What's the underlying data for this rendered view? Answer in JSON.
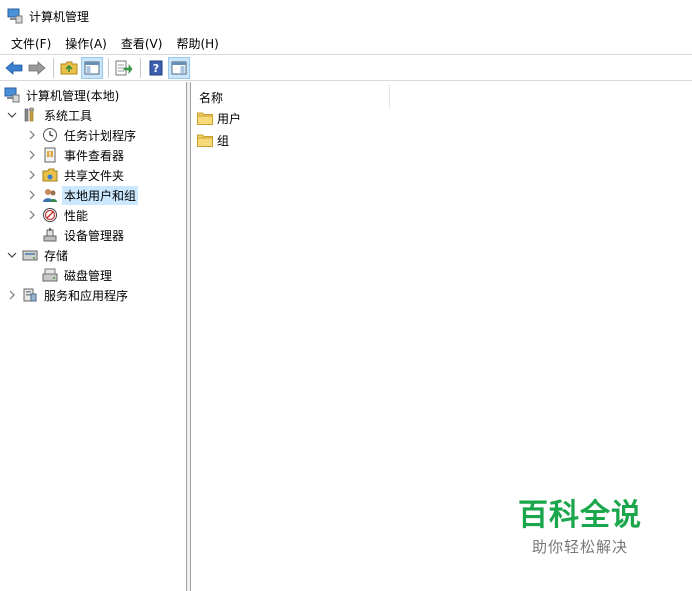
{
  "window": {
    "title": "计算机管理"
  },
  "menu": [
    {
      "label": "文件(F)"
    },
    {
      "label": "操作(A)"
    },
    {
      "label": "查看(V)"
    },
    {
      "label": "帮助(H)"
    }
  ],
  "toolbar": {
    "icons": [
      "back-arrow-icon",
      "forward-arrow-icon",
      "up-folder-icon",
      "show-hide-tree-icon",
      "export-list-icon",
      "help-icon",
      "show-hide-action-pane-icon"
    ]
  },
  "tree": {
    "root": "计算机管理(本地)",
    "system_tools": "系统工具",
    "task_scheduler": "任务计划程序",
    "event_viewer": "事件查看器",
    "shared_folders": "共享文件夹",
    "local_users_groups": "本地用户和组",
    "performance": "性能",
    "device_manager": "设备管理器",
    "storage": "存储",
    "disk_management": "磁盘管理",
    "services_apps": "服务和应用程序"
  },
  "list": {
    "column_name": "名称",
    "items": [
      {
        "name": "用户"
      },
      {
        "name": "组"
      }
    ]
  },
  "watermark": {
    "main": "百科全说",
    "sub": "助你轻松解决"
  },
  "colors": {
    "selection": "#cce8ff",
    "toolbar_pressed": "#cce4f7",
    "watermark_green": "#1aa64a"
  }
}
